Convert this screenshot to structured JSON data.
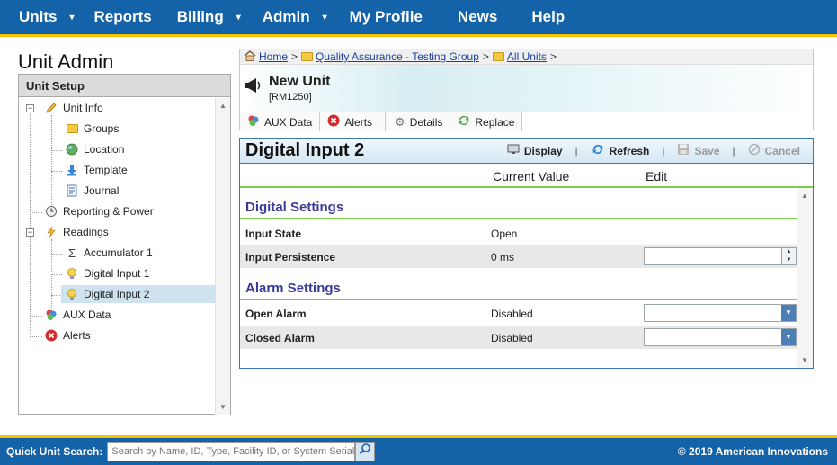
{
  "topnav": {
    "items": [
      {
        "label": "Units",
        "dropdown": true
      },
      {
        "label": "Reports",
        "dropdown": false
      },
      {
        "label": "Billing",
        "dropdown": true
      },
      {
        "label": "Admin",
        "dropdown": true
      },
      {
        "label": "My Profile",
        "dropdown": false
      },
      {
        "label": "News",
        "dropdown": false
      },
      {
        "label": "Help",
        "dropdown": false
      }
    ],
    "caret": "▾"
  },
  "sidebar": {
    "page_title": "Unit Admin",
    "header": "Unit Setup",
    "tree": [
      {
        "label": "Unit Info",
        "icon": "pencil-icon"
      },
      {
        "label": "Groups",
        "icon": "folder-icon"
      },
      {
        "label": "Location",
        "icon": "globe-icon"
      },
      {
        "label": "Template",
        "icon": "download-arrow-icon"
      },
      {
        "label": "Journal",
        "icon": "journal-icon"
      },
      {
        "label": "Reporting & Power",
        "icon": "clock-icon"
      },
      {
        "label": "Readings",
        "icon": "lightning-icon"
      },
      {
        "label": "Accumulator 1",
        "icon": "sigma-icon"
      },
      {
        "label": "Digital Input 1",
        "icon": "lightbulb-icon"
      },
      {
        "label": "Digital Input 2",
        "icon": "lightbulb-icon",
        "selected": true
      },
      {
        "label": "AUX Data",
        "icon": "aux-data-icon"
      },
      {
        "label": "Alerts",
        "icon": "alert-x-icon"
      }
    ]
  },
  "breadcrumb": {
    "items": [
      "Home",
      "Quality Assurance - Testing Group",
      "All Units"
    ],
    "separator": ">"
  },
  "unit": {
    "name": "New Unit",
    "id": "[RM1250]"
  },
  "tabs": [
    {
      "label": "AUX Data",
      "icon": "aux-data-icon"
    },
    {
      "label": "Alerts",
      "icon": "alert-x-icon"
    },
    {
      "label": "Details",
      "icon": "gear-icon"
    },
    {
      "label": "Replace",
      "icon": "replace-icon"
    }
  ],
  "panel": {
    "title": "Digital Input 2",
    "toolbar": {
      "display": "Display",
      "refresh": "Refresh",
      "save": "Save",
      "cancel": "Cancel",
      "divider": "|"
    },
    "columns": {
      "current_value": "Current Value",
      "edit": "Edit"
    },
    "digital_settings": {
      "title": "Digital Settings",
      "rows": [
        {
          "label": "Input State",
          "value": "Open",
          "edit_type": "none"
        },
        {
          "label": "Input Persistence",
          "value": "0 ms",
          "edit_type": "spinner",
          "edit_value": ""
        }
      ]
    },
    "alarm_settings": {
      "title": "Alarm Settings",
      "rows": [
        {
          "label": "Open Alarm",
          "value": "Disabled",
          "edit_type": "select",
          "edit_value": ""
        },
        {
          "label": "Closed Alarm",
          "value": "Disabled",
          "edit_type": "select",
          "edit_value": ""
        }
      ]
    }
  },
  "footer": {
    "quick_search_label": "Quick Unit Search:",
    "search_placeholder": "Search by Name, ID, Type, Facility ID, or System Serial",
    "copyright": "© 2019 American Innovations"
  },
  "colors": {
    "brand_blue": "#1462a8",
    "accent_yellow": "#f2c500",
    "section_green": "#7ccd4a",
    "section_title": "#3a3a9a"
  }
}
